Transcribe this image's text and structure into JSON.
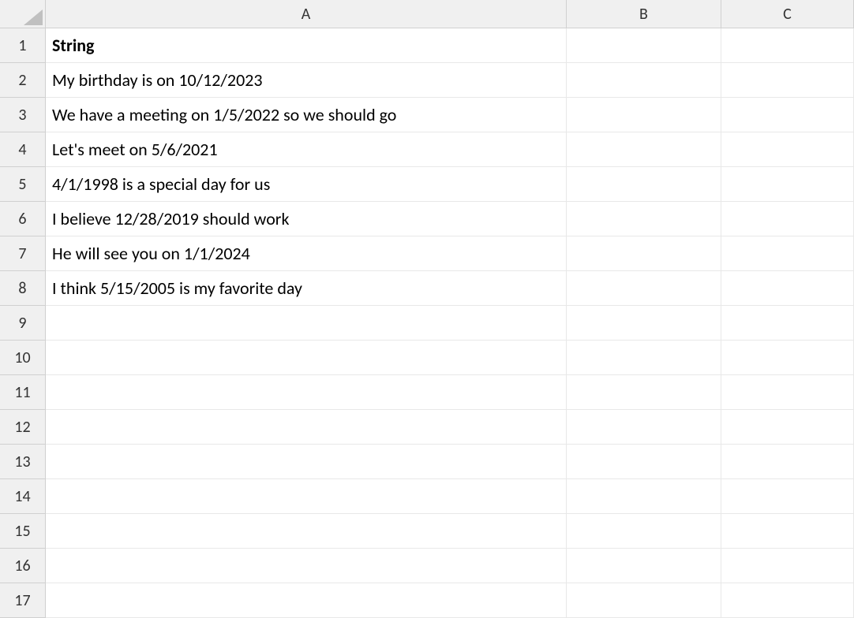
{
  "columns": [
    {
      "label": "A",
      "class": "col-a"
    },
    {
      "label": "B",
      "class": "col-b"
    },
    {
      "label": "C",
      "class": "col-c"
    }
  ],
  "rows": [
    {
      "num": "1",
      "cells": [
        {
          "value": "String",
          "bold": true
        },
        {
          "value": ""
        },
        {
          "value": ""
        }
      ]
    },
    {
      "num": "2",
      "cells": [
        {
          "value": "My birthday is on 10/12/2023"
        },
        {
          "value": ""
        },
        {
          "value": ""
        }
      ]
    },
    {
      "num": "3",
      "cells": [
        {
          "value": "We have a meeting on 1/5/2022 so we should go"
        },
        {
          "value": ""
        },
        {
          "value": ""
        }
      ]
    },
    {
      "num": "4",
      "cells": [
        {
          "value": "Let's meet on 5/6/2021"
        },
        {
          "value": ""
        },
        {
          "value": ""
        }
      ]
    },
    {
      "num": "5",
      "cells": [
        {
          "value": "4/1/1998 is a special day for us"
        },
        {
          "value": ""
        },
        {
          "value": ""
        }
      ]
    },
    {
      "num": "6",
      "cells": [
        {
          "value": "I believe 12/28/2019 should work"
        },
        {
          "value": ""
        },
        {
          "value": ""
        }
      ]
    },
    {
      "num": "7",
      "cells": [
        {
          "value": "He will see you on 1/1/2024"
        },
        {
          "value": ""
        },
        {
          "value": ""
        }
      ]
    },
    {
      "num": "8",
      "cells": [
        {
          "value": "I think 5/15/2005 is my favorite day"
        },
        {
          "value": ""
        },
        {
          "value": ""
        }
      ]
    },
    {
      "num": "9",
      "cells": [
        {
          "value": ""
        },
        {
          "value": ""
        },
        {
          "value": ""
        }
      ]
    },
    {
      "num": "10",
      "cells": [
        {
          "value": ""
        },
        {
          "value": ""
        },
        {
          "value": ""
        }
      ]
    },
    {
      "num": "11",
      "cells": [
        {
          "value": ""
        },
        {
          "value": ""
        },
        {
          "value": ""
        }
      ]
    },
    {
      "num": "12",
      "cells": [
        {
          "value": ""
        },
        {
          "value": ""
        },
        {
          "value": ""
        }
      ]
    },
    {
      "num": "13",
      "cells": [
        {
          "value": ""
        },
        {
          "value": ""
        },
        {
          "value": ""
        }
      ]
    },
    {
      "num": "14",
      "cells": [
        {
          "value": ""
        },
        {
          "value": ""
        },
        {
          "value": ""
        }
      ]
    },
    {
      "num": "15",
      "cells": [
        {
          "value": ""
        },
        {
          "value": ""
        },
        {
          "value": ""
        }
      ]
    },
    {
      "num": "16",
      "cells": [
        {
          "value": ""
        },
        {
          "value": ""
        },
        {
          "value": ""
        }
      ]
    },
    {
      "num": "17",
      "cells": [
        {
          "value": ""
        },
        {
          "value": ""
        },
        {
          "value": ""
        }
      ]
    }
  ]
}
